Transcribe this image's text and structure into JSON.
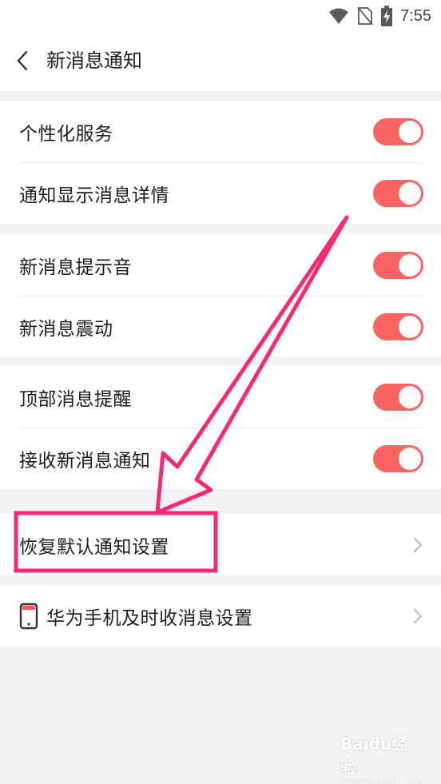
{
  "status_bar": {
    "time": "7:55",
    "icons": [
      "wifi-icon",
      "no-sim-icon",
      "battery-charging-icon"
    ]
  },
  "header": {
    "title": "新消息通知",
    "back_icon": "chevron-left-icon"
  },
  "groups": [
    {
      "items": [
        {
          "label": "个性化服务",
          "type": "toggle",
          "on": true
        },
        {
          "label": "通知显示消息详情",
          "type": "toggle",
          "on": true
        }
      ]
    },
    {
      "items": [
        {
          "label": "新消息提示音",
          "type": "toggle",
          "on": true
        },
        {
          "label": "新消息震动",
          "type": "toggle",
          "on": true
        }
      ]
    },
    {
      "items": [
        {
          "label": "顶部消息提醒",
          "type": "toggle",
          "on": true
        },
        {
          "label": "接收新消息通知",
          "type": "toggle",
          "on": true
        }
      ]
    },
    {
      "items": [
        {
          "label": "恢复默认通知设置",
          "type": "link"
        }
      ]
    },
    {
      "items": [
        {
          "label": "华为手机及时收消息设置",
          "type": "link",
          "icon": "phone-icon"
        }
      ]
    }
  ],
  "colors": {
    "toggle_on": "#f86462",
    "annotation": "#f52a77",
    "background": "#f3f3f3"
  },
  "annotation": {
    "shape": "arrow-and-box",
    "target": "恢复默认通知设置"
  },
  "watermark": {
    "main": "Baidu经验",
    "sub": "jingyan.baidu.com"
  }
}
